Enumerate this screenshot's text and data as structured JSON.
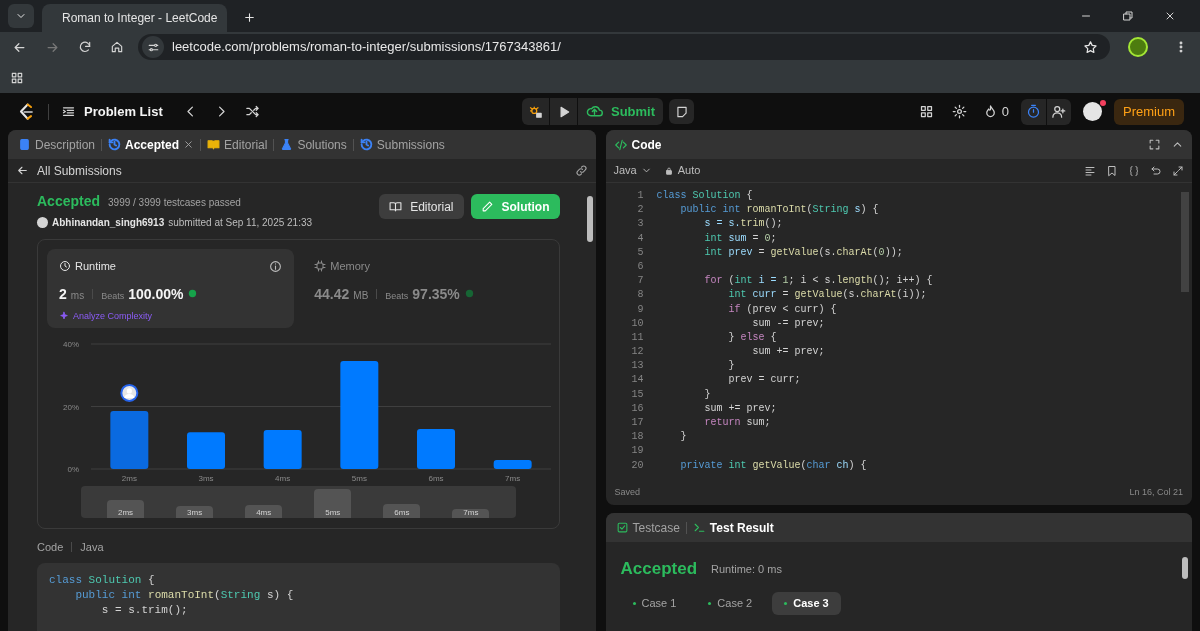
{
  "browser": {
    "tab_title": "Roman to Integer - LeetCode",
    "url": "leetcode.com/problems/roman-to-integer/submissions/1767343861/"
  },
  "header": {
    "problem_list": "Problem List",
    "submit": "Submit",
    "streak": "0",
    "premium": "Premium"
  },
  "left_tabs": [
    {
      "label": "Description",
      "selected": false,
      "color": "#3b82f6"
    },
    {
      "label": "Accepted",
      "selected": true,
      "color": "#3b82f6",
      "closable": true
    },
    {
      "label": "Editorial",
      "selected": false,
      "color": "#eab308"
    },
    {
      "label": "Solutions",
      "selected": false,
      "color": "#3b82f6"
    },
    {
      "label": "Submissions",
      "selected": false,
      "color": "#3b82f6"
    }
  ],
  "back_link": "All Submissions",
  "submission": {
    "status": "Accepted",
    "passed": "3999 / 3999 testcases passed",
    "user": "Abhinandan_singh6913",
    "submitted": "submitted at Sep 11, 2025 21:33",
    "buttons": [
      "Editorial",
      "Solution"
    ]
  },
  "stats": [
    {
      "kind": "runtime",
      "label": "Runtime",
      "value": "2",
      "unit": "ms",
      "beats_label": "Beats",
      "beats": "100.00%",
      "link": "Analyze Complexity",
      "selected": true
    },
    {
      "kind": "memory",
      "label": "Memory",
      "value": "44.42",
      "unit": "MB",
      "beats_label": "Beats",
      "beats": "97.35%",
      "selected": false
    }
  ],
  "chart_data": {
    "type": "bar",
    "categories": [
      "2ms",
      "3ms",
      "4ms",
      "5ms",
      "6ms",
      "7ms"
    ],
    "values": [
      18.6,
      11.8,
      12.5,
      34.6,
      12.8,
      2.9
    ],
    "ylim": [
      0,
      40
    ],
    "yticks": [
      {
        "value": 0,
        "label": "0%"
      },
      {
        "value": 20,
        "label": "20%"
      },
      {
        "value": 40,
        "label": "40%"
      }
    ],
    "annotations": [
      {
        "x": "2ms"
      }
    ]
  },
  "overview_labels": [
    "2ms",
    "3ms",
    "4ms",
    "5ms",
    "6ms",
    "7ms"
  ],
  "submitted_code": {
    "title": "Code",
    "language": "Java",
    "lines": [
      {
        "tokens": [
          {
            "text": "class ",
            "kind": "keyword"
          },
          {
            "text": "Solution ",
            "kind": "type"
          },
          {
            "text": "{",
            "kind": "plain"
          }
        ]
      },
      {
        "tokens": [
          {
            "text": "    public int ",
            "kind": "keyword"
          },
          {
            "text": "romanToInt",
            "kind": "function"
          },
          {
            "text": "(",
            "kind": "plain"
          },
          {
            "text": "String ",
            "kind": "type"
          },
          {
            "text": "s) {",
            "kind": "plain"
          }
        ]
      },
      {
        "tokens": [
          {
            "text": "        s = s.trim();",
            "kind": "plain"
          }
        ]
      }
    ]
  },
  "editor": {
    "title": "Code",
    "language": "Java",
    "mode": "Auto",
    "status": "Saved",
    "cursor": "Ln 16, Col 21",
    "lines": [
      {
        "number": "1",
        "tokens": [
          {
            "text": "class ",
            "kind": "keyword"
          },
          {
            "text": "Solution ",
            "kind": "type"
          },
          {
            "text": "{",
            "kind": "plain"
          }
        ]
      },
      {
        "number": "2",
        "tokens": [
          {
            "text": "    public int ",
            "kind": "keyword"
          },
          {
            "text": "romanToInt",
            "kind": "function"
          },
          {
            "text": "(",
            "kind": "plain"
          },
          {
            "text": "String ",
            "kind": "type"
          },
          {
            "text": "s",
            "kind": "variable"
          },
          {
            "text": ") {",
            "kind": "plain"
          }
        ]
      },
      {
        "number": "3",
        "tokens": [
          {
            "text": "        s = s.",
            "kind": "variable"
          },
          {
            "text": "trim",
            "kind": "function"
          },
          {
            "text": "();",
            "kind": "plain"
          }
        ]
      },
      {
        "number": "4",
        "tokens": [
          {
            "text": "        int ",
            "kind": "type"
          },
          {
            "text": "sum",
            "kind": "variable"
          },
          {
            "text": " = ",
            "kind": "plain"
          },
          {
            "text": "0",
            "kind": "number"
          },
          {
            "text": ";",
            "kind": "plain"
          }
        ]
      },
      {
        "number": "5",
        "tokens": [
          {
            "text": "        int ",
            "kind": "type"
          },
          {
            "text": "prev",
            "kind": "variable"
          },
          {
            "text": " = ",
            "kind": "plain"
          },
          {
            "text": "getValue",
            "kind": "function"
          },
          {
            "text": "(s.",
            "kind": "plain"
          },
          {
            "text": "charAt",
            "kind": "function"
          },
          {
            "text": "(",
            "kind": "plain"
          },
          {
            "text": "0",
            "kind": "number"
          },
          {
            "text": "));",
            "kind": "plain"
          }
        ]
      },
      {
        "number": "6"
      },
      {
        "number": "7",
        "tokens": [
          {
            "text": "        for ",
            "kind": "control"
          },
          {
            "text": "(",
            "kind": "plain"
          },
          {
            "text": "int ",
            "kind": "type"
          },
          {
            "text": "i = ",
            "kind": "variable"
          },
          {
            "text": "1",
            "kind": "number"
          },
          {
            "text": "; i < s.",
            "kind": "plain"
          },
          {
            "text": "length",
            "kind": "function"
          },
          {
            "text": "(); i++) {",
            "kind": "plain"
          }
        ]
      },
      {
        "number": "8",
        "tokens": [
          {
            "text": "            int ",
            "kind": "type"
          },
          {
            "text": "curr",
            "kind": "variable"
          },
          {
            "text": " = ",
            "kind": "plain"
          },
          {
            "text": "getValue",
            "kind": "function"
          },
          {
            "text": "(s.",
            "kind": "plain"
          },
          {
            "text": "charAt",
            "kind": "function"
          },
          {
            "text": "(i));",
            "kind": "plain"
          }
        ]
      },
      {
        "number": "9",
        "tokens": [
          {
            "text": "            if ",
            "kind": "control"
          },
          {
            "text": "(prev < curr) {",
            "kind": "plain"
          }
        ]
      },
      {
        "number": "10",
        "tokens": [
          {
            "text": "                sum -= prev;",
            "kind": "plain"
          }
        ]
      },
      {
        "number": "11",
        "tokens": [
          {
            "text": "            } ",
            "kind": "plain"
          },
          {
            "text": "else",
            "kind": "control"
          },
          {
            "text": " {",
            "kind": "plain"
          }
        ]
      },
      {
        "number": "12",
        "tokens": [
          {
            "text": "                sum += prev;",
            "kind": "plain"
          }
        ]
      },
      {
        "number": "13",
        "tokens": [
          {
            "text": "            }",
            "kind": "plain"
          }
        ]
      },
      {
        "number": "14",
        "tokens": [
          {
            "text": "            prev = curr;",
            "kind": "plain"
          }
        ]
      },
      {
        "number": "15",
        "tokens": [
          {
            "text": "        }",
            "kind": "plain"
          }
        ]
      },
      {
        "number": "16",
        "tokens": [
          {
            "text": "        sum += prev;",
            "kind": "plain"
          }
        ]
      },
      {
        "number": "17",
        "tokens": [
          {
            "text": "        return ",
            "kind": "control"
          },
          {
            "text": "sum;",
            "kind": "plain"
          }
        ]
      },
      {
        "number": "18",
        "tokens": [
          {
            "text": "    }",
            "kind": "plain"
          }
        ]
      },
      {
        "number": "19"
      },
      {
        "number": "20",
        "tokens": [
          {
            "text": "    private ",
            "kind": "keyword"
          },
          {
            "text": "int ",
            "kind": "type"
          },
          {
            "text": "getValue",
            "kind": "function"
          },
          {
            "text": "(",
            "kind": "plain"
          },
          {
            "text": "char ",
            "kind": "keyword"
          },
          {
            "text": "ch",
            "kind": "variable"
          },
          {
            "text": ") {",
            "kind": "plain"
          }
        ]
      }
    ]
  },
  "test_tabs": [
    {
      "label": "Testcase",
      "selected": false
    },
    {
      "label": "Test Result",
      "selected": true
    }
  ],
  "test_result": {
    "status": "Accepted",
    "runtime": "Runtime: 0 ms",
    "cases": [
      {
        "label": "Case 1",
        "selected": false
      },
      {
        "label": "Case 2",
        "selected": false
      },
      {
        "label": "Case 3",
        "selected": true
      }
    ]
  }
}
